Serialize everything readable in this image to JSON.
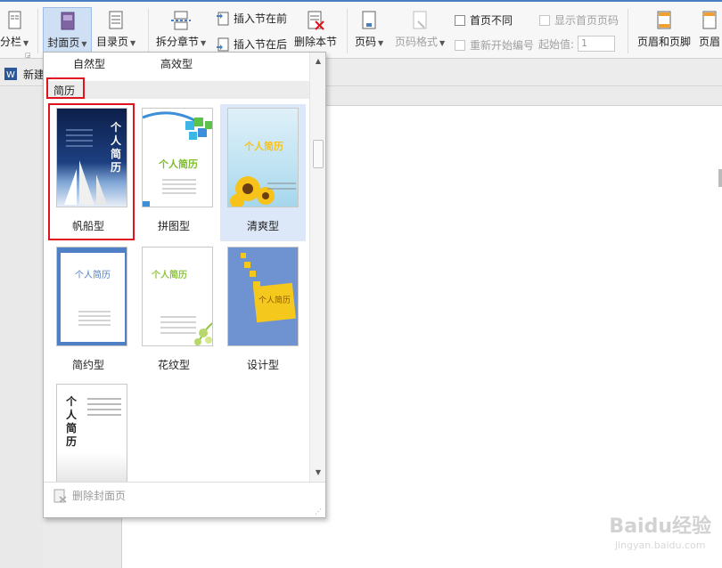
{
  "ribbon": {
    "columns_label": "分栏",
    "cover_label": "封面页",
    "toc_label": "目录页",
    "split_section_label": "拆分章节",
    "insert_section_before": "插入节在前",
    "insert_section_after": "插入节在后",
    "delete_section": "删除本节",
    "page_number_label": "页码",
    "page_number_format": "页码格式",
    "different_first_page": "首页不同",
    "show_first_page_number": "显示首页页码",
    "restart_numbering": "重新开始编号",
    "start_value_label": "起始值:",
    "start_value": "1",
    "header_footer_label": "页眉和页脚",
    "header_label": "页眉"
  },
  "document": {
    "tab_label": "新建"
  },
  "dropdown": {
    "previous_row_labels": [
      "自然型",
      "高效型"
    ],
    "section_title": "简历",
    "templates": [
      {
        "label": "帆船型",
        "title_text": "个人简历"
      },
      {
        "label": "拼图型",
        "title_text": "个人简历"
      },
      {
        "label": "清爽型",
        "title_text": "个人简历"
      },
      {
        "label": "简约型",
        "title_text": "个人简历"
      },
      {
        "label": "花纹型",
        "title_text": "个人简历"
      },
      {
        "label": "设计型",
        "title_text": "个人简历"
      },
      {
        "label": "",
        "title_text": "个人简历"
      }
    ],
    "remove_cover_label": "删除封面页"
  },
  "watermark": {
    "brand": "Baidu经验",
    "url": "jingyan.baidu.com"
  },
  "colors": {
    "accent": "#4a7fc4",
    "highlight_red": "#e0141e",
    "selected_bg": "#dce8f8"
  }
}
